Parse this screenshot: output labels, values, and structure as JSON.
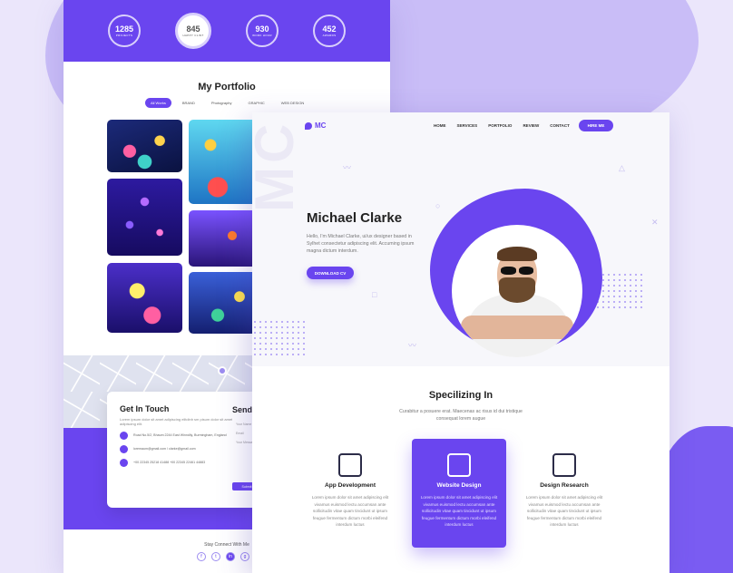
{
  "stats": [
    {
      "num": "1285",
      "label": "PROJECTS"
    },
    {
      "num": "845",
      "label": "HAPPY CLINT"
    },
    {
      "num": "930",
      "label": "WORK HOUR"
    },
    {
      "num": "452",
      "label": "AWARDS"
    }
  ],
  "portfolio": {
    "title": "My Portfolio",
    "filters": [
      "All Works",
      "BRAND",
      "Photography",
      "GRAPHIC",
      "WEB DESIGN"
    ]
  },
  "contact": {
    "title": "Get In Touch",
    "text": "Lorem ipsum dolor sit amet adipiscing elitdinh sm pisum dolor sit amet adipiscing elit.",
    "address": "Road No.5/2, Bhaum 2244 East Winndlly, Burmingham, England",
    "email": "loremaum@gmail.com / clarke@gmail.com",
    "phone": "+00 22345 25218 41488 +00 22345 22461 44883",
    "send_title": "Send",
    "fields": [
      "Your Name",
      "Email",
      "Your Message"
    ],
    "send_btn": "Submit"
  },
  "footer": {
    "stay": "Stay Connect With Me",
    "socials": [
      "f",
      "t",
      "in",
      "g"
    ]
  },
  "hero": {
    "logo": "MC",
    "menu": [
      "HOME",
      "SERVICES",
      "PORTFOLIO",
      "REVIEW",
      "CONTACT"
    ],
    "hire": "HIRE ME",
    "watermark": "MC",
    "name": "Michael Clarke",
    "bio": "Hello, I'm Michael Clarke, ui/ux designer based in Sylhet consectetur adipiscing elit. Accuming ipsum magna dictum interdum.",
    "download": "DOWNLOAD CV"
  },
  "specializing": {
    "title": "Specilizing In",
    "subtitle": "Curabitur a posuere erat. Maecenas ac risus id dui tristique consequat lorem augue",
    "cards": [
      {
        "name": "App Development",
        "text": "Lorem ipsum dolor sit amet adipiscing elit vivamus euismod lectu accumsan ante sollicitudin vitae quam tincidunt ut ipsum feugue fermentum dictum morbi eleifend interdum luctus"
      },
      {
        "name": "Website Design",
        "text": "Lorem ipsum dolor sit amet adipiscing elit vivamus euismod lectu accumsan ante sollicitudin vitae quam tincidunt ut ipsum feugue fermentum dictum morbi eleifend interdum luctus"
      },
      {
        "name": "Design Research",
        "text": "Lorem ipsum dolor sit amet adipiscing elit vivamus euismod lectu accumsan ante sollicitudin vitae quam tincidunt ut ipsum feugue fermentum dictum morbi eleifend interdum luctus"
      }
    ]
  },
  "colors": {
    "accent": "#6a45ef",
    "background": "#ebe6fb"
  }
}
